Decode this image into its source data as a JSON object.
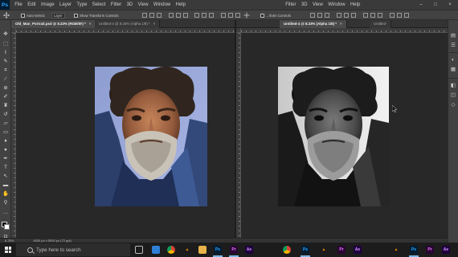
{
  "app": {
    "logo": "Ps"
  },
  "menu_left": [
    "File",
    "Edit",
    "Image",
    "Layer",
    "Type",
    "Select",
    "Filter",
    "3D",
    "View",
    "Window",
    "Help"
  ],
  "menu_right": [
    "Filter",
    "3D",
    "View",
    "Window",
    "Help"
  ],
  "options_left": {
    "auto_select": "Auto-Select:",
    "target": "Layer",
    "transform": "Show Transform Controls"
  },
  "options_right": {
    "transform": "...rform Controls"
  },
  "left_pane": {
    "tabs": [
      {
        "label": "Old_Man_Portrait.psd @ 8.33% (RGB/8#) *",
        "close": "×"
      },
      {
        "label": "Untitled-4 @ 8.33% (Alpha 1/8) *",
        "close": "×"
      }
    ]
  },
  "right_pane": {
    "tabs": [
      {
        "label": "Untitled-4 @ 8.33% (Alpha 1/8) *",
        "close": "×"
      },
      {
        "label": "Untitled-",
        "close": ""
      }
    ]
  },
  "status": {
    "zoom": "8.33%",
    "doc_info": "4000 px x 5000 px (72 ppi)"
  },
  "taskbar": {
    "search_placeholder": "Type here to search"
  },
  "icons": {
    "menubar": [
      "photoshop-logo",
      "minimize-icon",
      "maximize-icon",
      "close-icon"
    ],
    "tools": [
      "move-icon",
      "marquee-icon",
      "lasso-icon",
      "quick-select-icon",
      "crop-icon",
      "eyedropper-icon",
      "healing-brush-icon",
      "brush-icon",
      "clone-stamp-icon",
      "history-brush-icon",
      "eraser-icon",
      "gradient-icon",
      "blur-icon",
      "dodge-icon",
      "pen-icon",
      "type-icon",
      "path-select-icon",
      "shape-icon",
      "hand-icon",
      "zoom-icon"
    ],
    "taskbar": [
      "windows-start-icon",
      "search-icon",
      "task-view-icon",
      "store-icon",
      "chrome-icon",
      "vlc-icon",
      "folder-icon",
      "photoshop-icon",
      "premiere-icon",
      "after-effects-icon",
      "chrome-icon",
      "photoshop-icon",
      "vlc-icon",
      "premiere-icon",
      "after-effects-icon",
      "vlc-icon",
      "photoshop-icon",
      "premiere-icon",
      "after-effects-icon"
    ]
  },
  "colors": {
    "accent": "#31a8ff",
    "panel": "#424242",
    "canvas": "#282828",
    "menubar": "#3a3a3a"
  }
}
